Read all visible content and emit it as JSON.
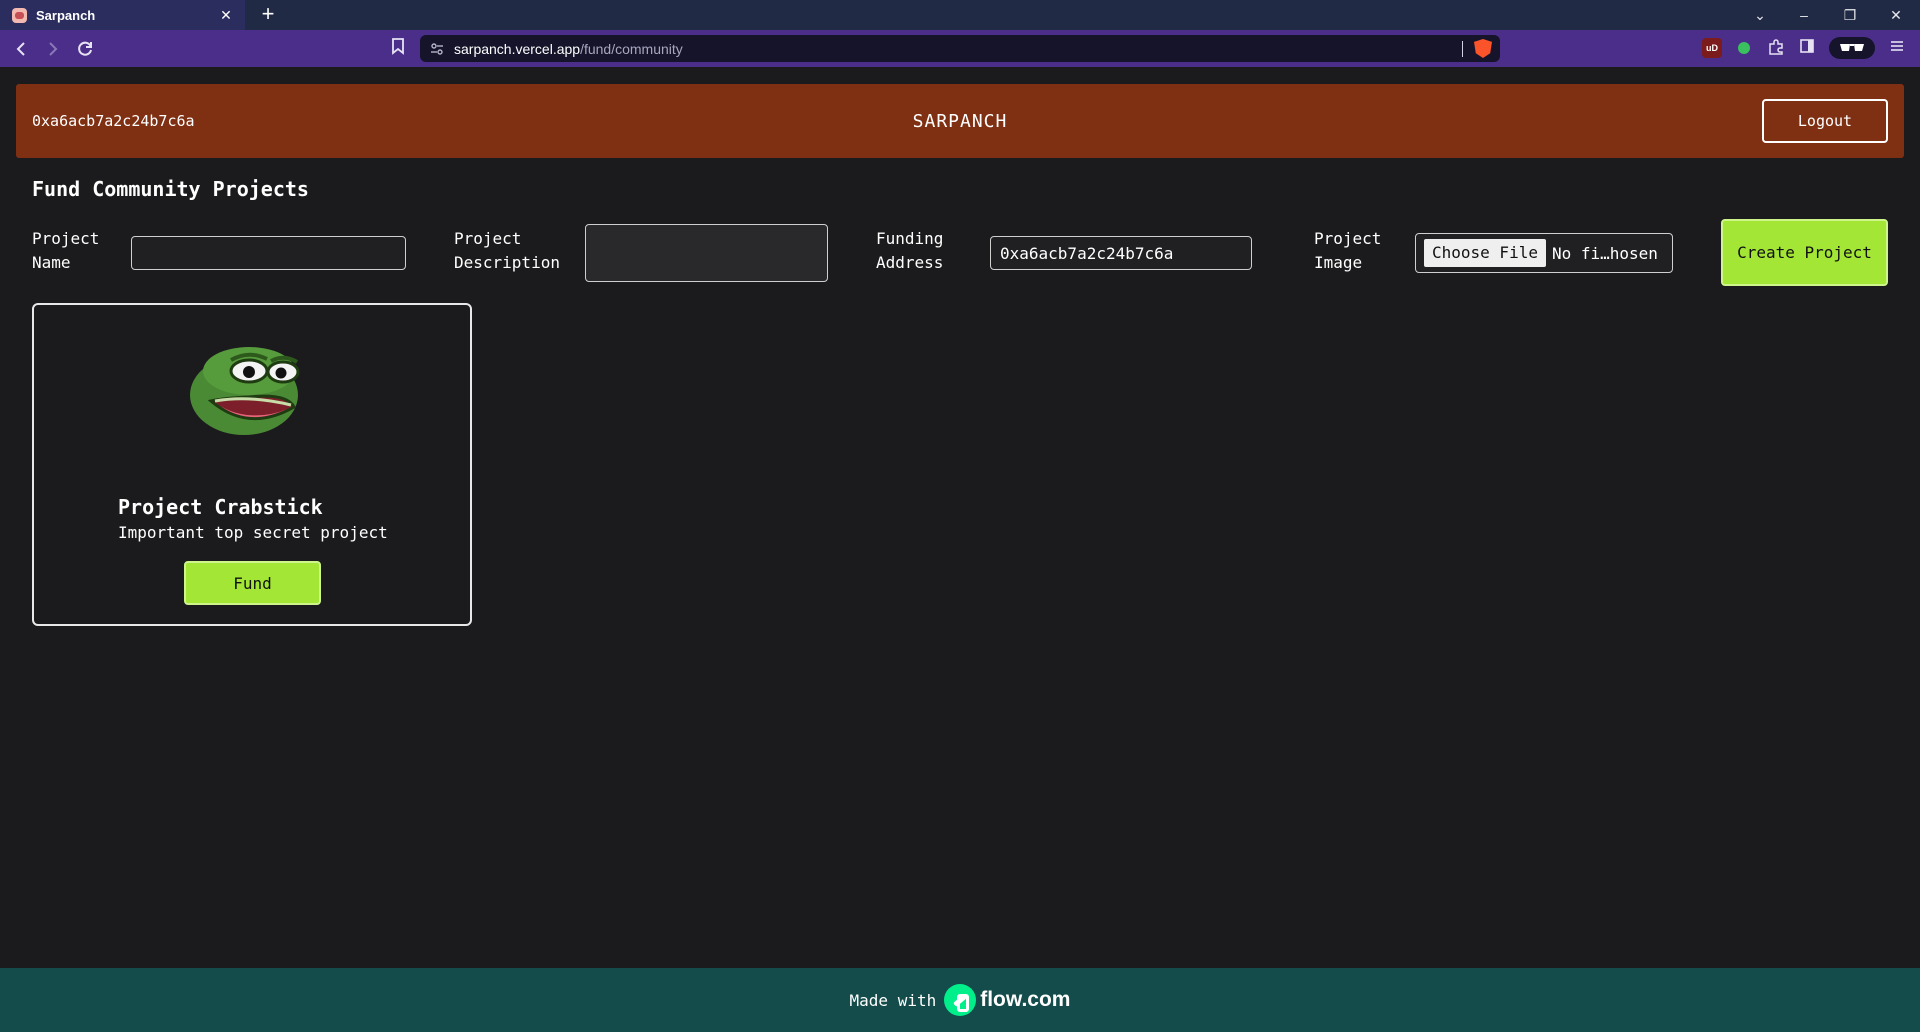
{
  "browser": {
    "tab_title": "Sarpanch",
    "tab_close": "✕",
    "new_tab": "+",
    "url_host": "sarpanch.vercel.app",
    "url_path": "/fund/community",
    "window_controls": {
      "dropdown": "⌄",
      "minimize": "–",
      "restore": "❐",
      "close": "✕"
    },
    "extensions": {
      "ublock_label": "uD"
    }
  },
  "header": {
    "wallet_address": "0xa6acb7a2c24b7c6a",
    "brand": "SARPANCH",
    "logout_label": "Logout"
  },
  "form": {
    "title": "Fund Community Projects",
    "project_name_label": "Project Name",
    "project_name_value": "",
    "project_description_label": "Project Description",
    "project_description_value": "",
    "funding_address_label": "Funding Address",
    "funding_address_value": "0xa6acb7a2c24b7c6a",
    "project_image_label": "Project Image",
    "file_button_label": "Choose File",
    "file_status": "No fi…hosen",
    "create_label": "Create Project"
  },
  "projects": [
    {
      "name": "Project Crabstick",
      "description": "Important top secret project",
      "fund_label": "Fund",
      "image_icon": "frog-face-image"
    }
  ],
  "footer": {
    "made_with": "Made with",
    "brand": "flow.com",
    "brand_color": "#00ef8b"
  },
  "colors": {
    "header_bg": "#7f3013",
    "accent_green": "#a3e635",
    "footer_bg": "#134c4a",
    "page_bg": "#1b1b1d"
  }
}
